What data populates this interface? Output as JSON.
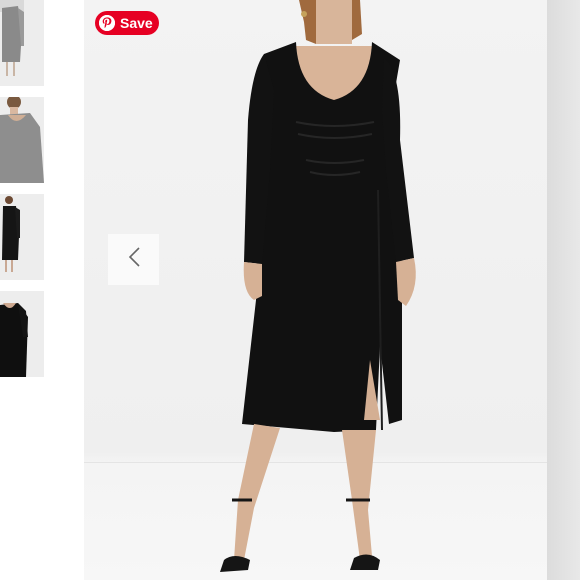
{
  "pin_button": {
    "label": "Save",
    "icon": "pinterest-icon",
    "color": "#e60023"
  },
  "gallery": {
    "thumbnails": [
      {
        "icon": "dress-thumbnail-1"
      },
      {
        "icon": "dress-thumbnail-2"
      },
      {
        "icon": "dress-thumbnail-3"
      },
      {
        "icon": "dress-thumbnail-4"
      }
    ],
    "prev_icon": "chevron-left-icon",
    "main_image": "black-long-sleeve-midi-dress-photo"
  }
}
